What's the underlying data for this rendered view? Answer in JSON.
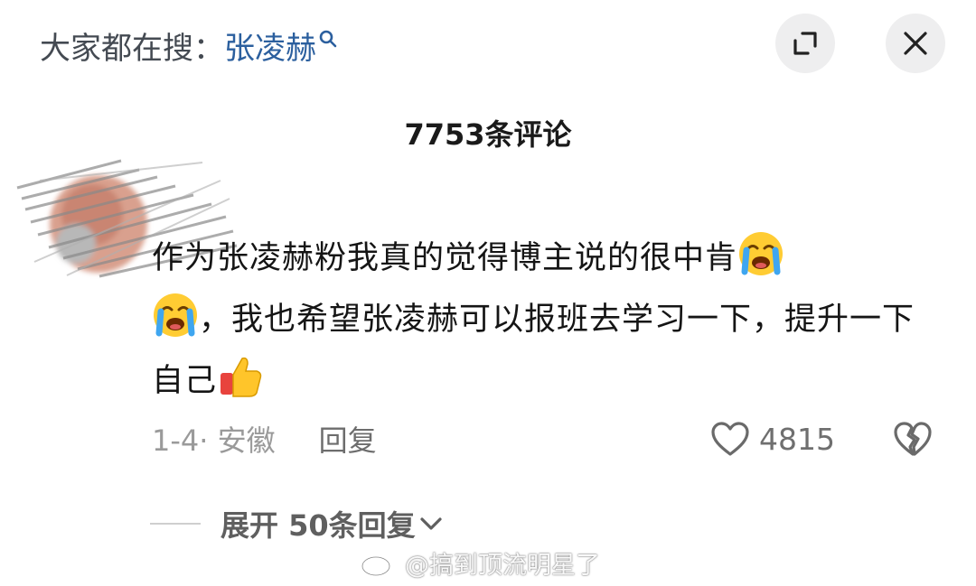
{
  "header": {
    "search_prefix": "大家都在搜：",
    "search_keyword": "张凌赫",
    "search_icon": "search-icon",
    "expand_icon": "expand-icon",
    "close_icon": "close-icon"
  },
  "comments_panel": {
    "count_label": "7753条评论"
  },
  "comment": {
    "avatar": "blurred-avatar",
    "text_part1": "作为张凌赫粉我真的觉得博主说的很中肯",
    "emoji1": "loudly-crying-face",
    "emoji2": "loudly-crying-face",
    "text_part2": "，我也希望张凌赫可以报班去学习一下，提升一下自己",
    "emoji3": "thumbs-up",
    "date_location": "1-4· 安徽",
    "reply_label": "回复",
    "like_count": "4815",
    "like_icon": "heart-outline-icon",
    "dislike_icon": "broken-heart-icon",
    "expand_replies_label": "展开 50条回复"
  },
  "watermark": {
    "text": "@搞到顶流明星了",
    "icon": "weibo-logo"
  },
  "colors": {
    "keyword": "#2b5f9e",
    "text": "#151515",
    "muted": "#9a9a9a",
    "button_bg": "#eeeeef"
  }
}
